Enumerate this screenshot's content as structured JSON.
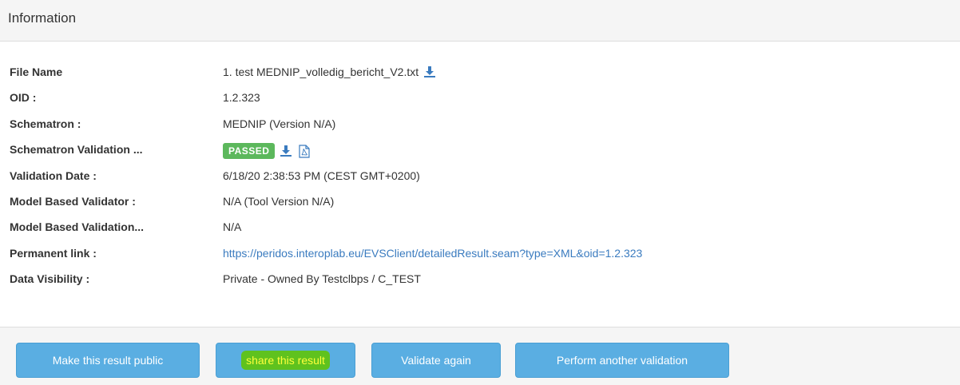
{
  "panel": {
    "title": "Information"
  },
  "info": {
    "rows": [
      {
        "label": "File Name",
        "value": "1. test MEDNIP_volledig_bericht_V2.txt"
      },
      {
        "label": "OID :",
        "value": "1.2.323"
      },
      {
        "label": "Schematron :",
        "value": "MEDNIP (Version N/A)"
      },
      {
        "label": "Schematron Validation ...",
        "value": "PASSED"
      },
      {
        "label": "Validation Date :",
        "value": "6/18/20 2:38:53 PM (CEST GMT+0200)"
      },
      {
        "label": "Model Based Validator :",
        "value": "N/A (Tool Version N/A)"
      },
      {
        "label": "Model Based Validation...",
        "value": "N/A"
      },
      {
        "label": "Permanent link :",
        "value": "https://peridos.interoplab.eu/EVSClient/detailedResult.seam?type=XML&oid=1.2.323"
      },
      {
        "label": "Data Visibility :",
        "value": "Private - Owned By Testclbps / C_TEST"
      }
    ]
  },
  "buttons": {
    "make_public": "Make this result public",
    "share": "share this result",
    "validate_again": "Validate again",
    "perform_another": "Perform another validation"
  },
  "icons": {
    "download": "download-icon",
    "pdf": "pdf-icon"
  },
  "colors": {
    "passed_badge": "#5cb85c",
    "button": "#5aaee2",
    "link": "#3a7bbf",
    "highlight": "#5fc21e"
  }
}
